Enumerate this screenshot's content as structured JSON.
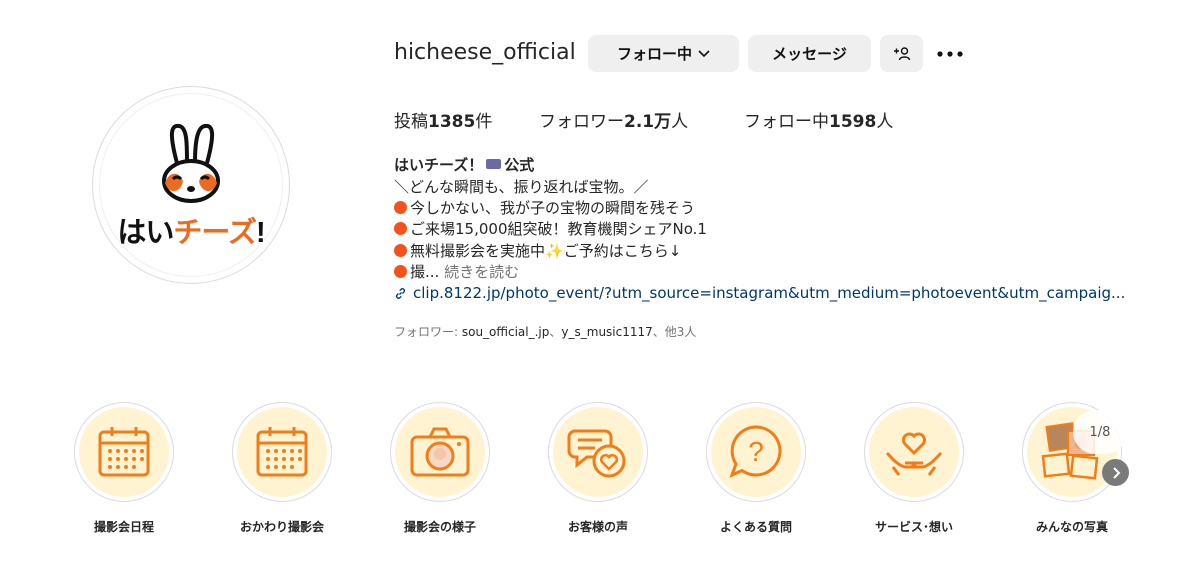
{
  "profile": {
    "username": "hicheese_official",
    "logo_text_black1": "はい",
    "logo_text_orange": "チーズ",
    "logo_text_black2": "!"
  },
  "actions": {
    "follow_label": "フォロー中",
    "message_label": "メッセージ",
    "add_user_icon": "add-person-icon",
    "more_icon": "more-icon"
  },
  "stats": {
    "posts_prefix": "投稿",
    "posts_value": "1385",
    "posts_suffix": "件",
    "followers_prefix": "フォロワー",
    "followers_value": "2.1万",
    "followers_suffix": "人",
    "following_prefix": "フォロー中",
    "following_value": "1598",
    "following_suffix": "人"
  },
  "bio": {
    "name_part1": "はいチーズ！",
    "name_part2": "公式",
    "line1": "＼どんな瞬間も、振り返れば宝物。／",
    "line2": "今しかない、我が子の宝物の瞬間を残そう",
    "line3": "ご来場15,000組突破！教育機関シェアNo.1",
    "line4a": "無料撮影会を実施中",
    "line4b": "ご予約はこちら↓",
    "line5": "撮...",
    "more_label": "続きを読む",
    "link_text": "clip.8122.jp/photo_event/?utm_source=instagram&utm_medium=photoevent&utm_campaig...",
    "followed_by_prefix": "フォロワー: ",
    "followed_by_user1": "sou_official_.jp",
    "followed_by_sep": "、",
    "followed_by_user2": "y_s_music1117",
    "followed_by_suffix": "、他3人"
  },
  "highlights": [
    {
      "label": "撮影会日程",
      "icon": "calendar-icon"
    },
    {
      "label": "おかわり撮影会",
      "icon": "calendar-icon"
    },
    {
      "label": "撮影会の様子",
      "icon": "camera-icon"
    },
    {
      "label": "お客様の声",
      "icon": "chat-heart-icon"
    },
    {
      "label": "よくある質問",
      "icon": "question-bubble-icon"
    },
    {
      "label": "サービス･想い",
      "icon": "hands-heart-icon"
    },
    {
      "label": "みんなの写真",
      "icon": "photos-icon"
    }
  ],
  "carousel": {
    "counter": "1/8"
  },
  "colors": {
    "accent": "#f07d1a",
    "highlight_bg": "#fff3d1",
    "link": "#00376b"
  }
}
